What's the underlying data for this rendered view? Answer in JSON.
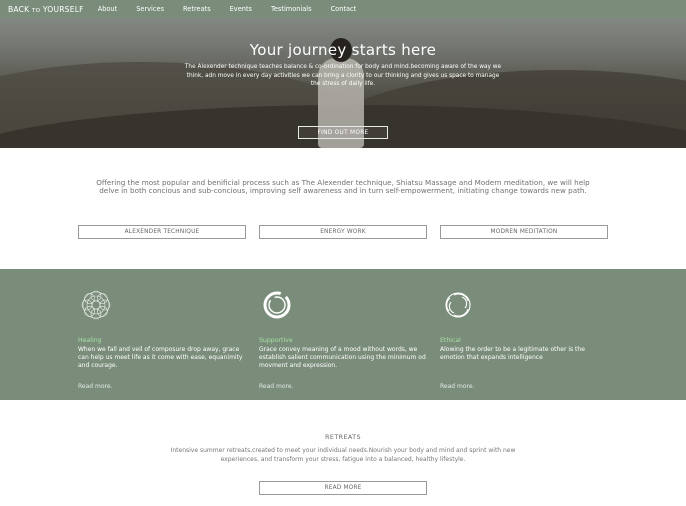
{
  "nav": {
    "logo_main": "BACK",
    "logo_small": "TO",
    "logo_end": "YOURSELF",
    "items": [
      "About",
      "Services",
      "Retreats",
      "Events",
      "Testimonials",
      "Contact"
    ]
  },
  "hero": {
    "title": "Your journey starts here",
    "text": "The Alexender technique teaches balance & co-ordination for body and mind.becoming aware of the way we think, adn move in every day activities we can bring a clority to our thinking and gives us space to manage the stress of daily life.",
    "button": "FIND OUT MORE"
  },
  "intro": {
    "text": "Offering the most popular and benificial process such as The Alexender technique, Shiatsu Massage and Modern meditation, we will help delve in both concious and sub-concious, improving self awareness and in turn self-empowerment, initiating change towards new path.",
    "buttons": [
      "ALEXENDER TECHNIQUE",
      "ENERGY WORK",
      "MODREN MEDITATION"
    ]
  },
  "features": [
    {
      "icon": "mandala-icon",
      "title": "Healing",
      "text": "When we fall and veil of composure drop away, grace can help us meet life as it come with ease, equanimity and courage.",
      "more": "Read more."
    },
    {
      "icon": "ring-icon",
      "title": "Supportive",
      "text": "Grace convey meaning of a mood without words, we establish salient communication using the minimum od movment and expression.",
      "more": "Read more."
    },
    {
      "icon": "swirl-icon",
      "title": "Ethical",
      "text": "Alowing the order to be a legitimate other is the emotion that expands intelligence",
      "more": "Read more."
    }
  ],
  "retreats": {
    "title": "RETREATS",
    "text": "Intensive summer retreats,created to meet your individual needs.Nourish your body and mind and sprint with new experiences, and transform your stress, fatigue into a balanced, healthy lifestyle.",
    "button": "READ MORE"
  },
  "colors": {
    "green": "#7a8d7b",
    "accent": "#a6e0a2"
  }
}
